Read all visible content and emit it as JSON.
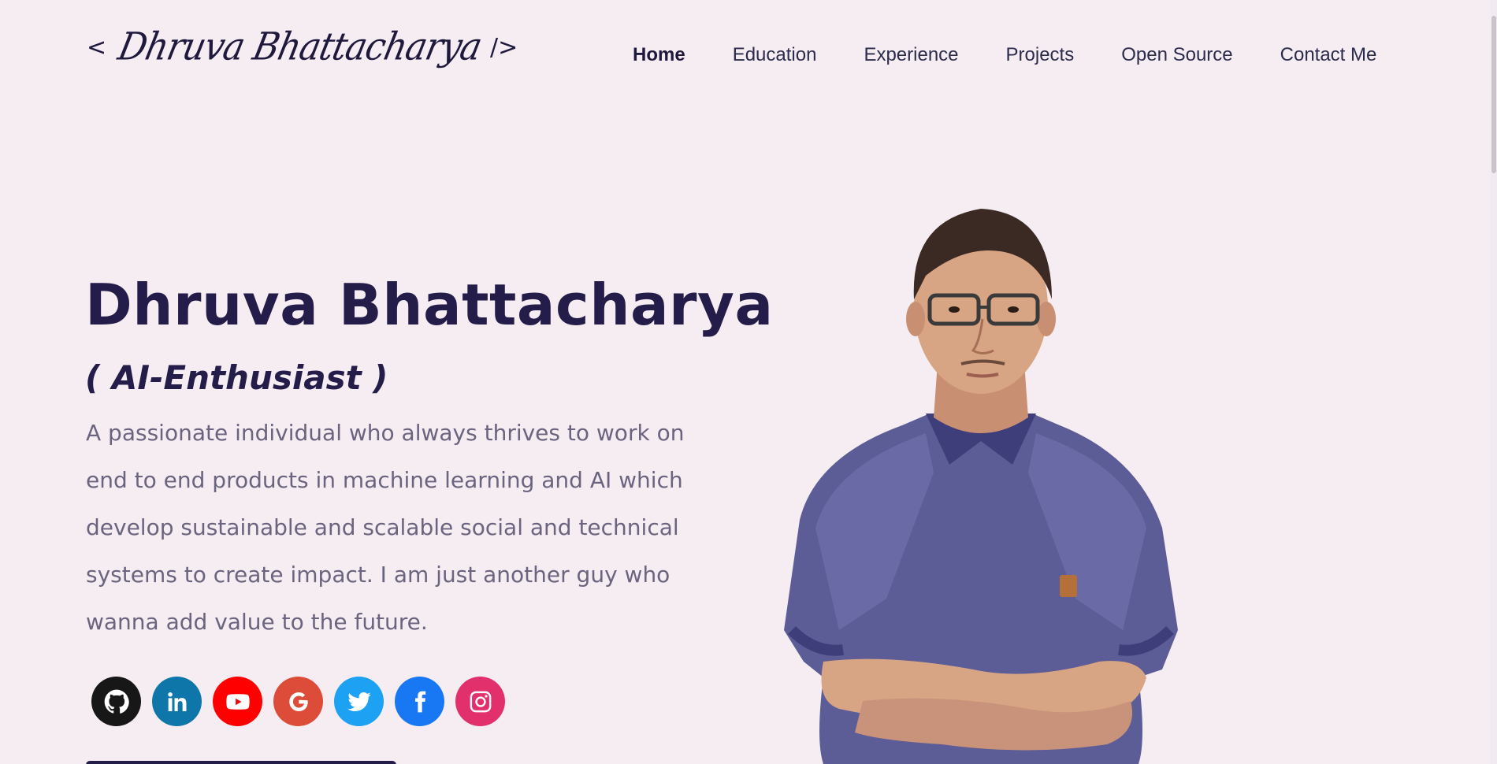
{
  "header": {
    "logo": {
      "open_bracket": "<",
      "signature": "Dhruva Bhattacharya",
      "close_bracket": "/>"
    },
    "nav": [
      {
        "label": "Home",
        "active": true
      },
      {
        "label": "Education"
      },
      {
        "label": "Experience"
      },
      {
        "label": "Projects"
      },
      {
        "label": "Open Source"
      },
      {
        "label": "Contact Me"
      }
    ]
  },
  "hero": {
    "title": "Dhruva Bhattacharya",
    "subtitle": "( AI-Enthusiast )",
    "description": "A passionate individual who always thrives to work on end to end products in machine learning and AI which develop sustainable and scalable social and technical systems to create impact. I am just another guy who wanna add value to the future."
  },
  "social": [
    {
      "icon": "github-icon",
      "color": "#181717"
    },
    {
      "icon": "linkedin-icon",
      "color": "#0e76a8"
    },
    {
      "icon": "youtube-icon",
      "color": "#ff0000"
    },
    {
      "icon": "google-icon",
      "color": "#dd4b39"
    },
    {
      "icon": "twitter-icon",
      "color": "#1da1f2"
    },
    {
      "icon": "facebook-icon",
      "color": "#1877f2"
    },
    {
      "icon": "instagram-icon",
      "color": "#e1306c"
    }
  ],
  "colors": {
    "background": "#f6edf3",
    "heading": "#241c49",
    "body_text": "#6a647e"
  }
}
